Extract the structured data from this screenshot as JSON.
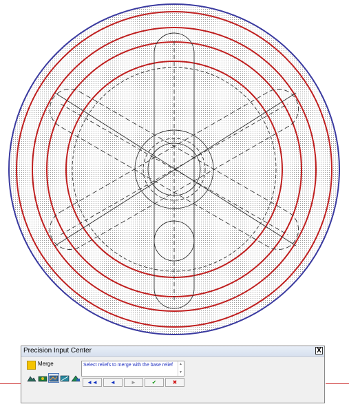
{
  "panel": {
    "title": "Precision Input Center",
    "close_glyph": "X",
    "merge_label": "Merge",
    "swatch_color": "#f5c400",
    "message": "Select reliefs to merge with the base relief",
    "tools": [
      "relief-tool-icon",
      "merge-tool-icon",
      "texture-tool-icon",
      "surface-tool-icon",
      "blend-tool-icon"
    ],
    "nav": {
      "first": "◄◄",
      "prev": "◄",
      "next": "►",
      "ok": "✔",
      "cancel": "✖"
    }
  },
  "colors": {
    "outer_ring": "#3a3aa0",
    "red_rings": "#c02020",
    "wire": "#303030",
    "ok": "#1a9a1a",
    "cancel": "#d01010",
    "nav_arrows": "#1030c0"
  }
}
